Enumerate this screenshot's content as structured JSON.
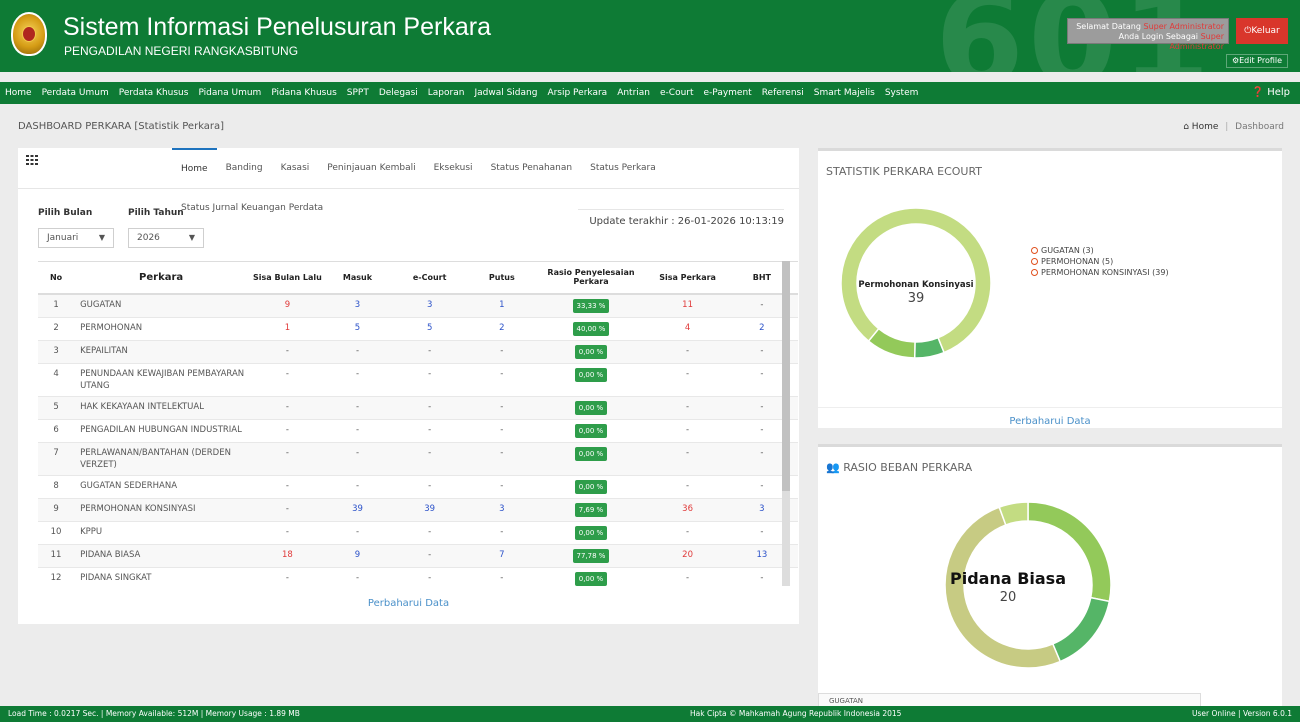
{
  "header": {
    "title": "Sistem Informasi Penelusuran Perkara",
    "subtitle": "PENGADILAN NEGERI RANGKASBITUNG",
    "watermark": "601",
    "welcome_line1": "Selamat Datang",
    "welcome_user1": "Super Administrator",
    "welcome_line2": "Anda Login Sebagai",
    "welcome_user2": "Super Administrator",
    "logout_label": "Keluar",
    "edit_profile_label": "Edit Profile"
  },
  "nav": {
    "items": [
      "Home",
      "Perdata Umum",
      "Perdata Khusus",
      "Pidana Umum",
      "Pidana Khusus",
      "SPPT",
      "Delegasi",
      "Laporan",
      "Jadwal Sidang",
      "Arsip Perkara",
      "Antrian",
      "e-Court",
      "e-Payment",
      "Referensi",
      "Smart Majelis",
      "System"
    ],
    "help": "Help"
  },
  "breadcrumb": {
    "heading": "DASHBOARD PERKARA",
    "heading_sub": "[Statistik Perkara]",
    "home": "Home",
    "current": "Dashboard"
  },
  "tabs": [
    "Home",
    "Banding",
    "Kasasi",
    "Peninjauan Kembali",
    "Eksekusi",
    "Status Penahanan",
    "Status Perkara",
    "Status Jurnal Keuangan Perdata"
  ],
  "filters": {
    "bulan_label": "Pilih Bulan",
    "bulan_value": "Januari",
    "tahun_label": "Pilih Tahun",
    "tahun_value": "2026",
    "updated": "Update terakhir : 26-01-2026 10:13:19"
  },
  "table": {
    "headers": [
      "No",
      "Perkara",
      "Sisa Bulan Lalu",
      "Masuk",
      "e-Court",
      "Putus",
      "Rasio Penyelesaian Perkara",
      "Sisa Perkara",
      "BHT"
    ],
    "rows": [
      [
        "1",
        "GUGATAN",
        "9",
        "3",
        "3",
        "1",
        "33,33 %",
        "11",
        "-"
      ],
      [
        "2",
        "PERMOHONAN",
        "1",
        "5",
        "5",
        "2",
        "40,00 %",
        "4",
        "2"
      ],
      [
        "3",
        "KEPAILITAN",
        "-",
        "-",
        "-",
        "-",
        "0,00 %",
        "-",
        "-"
      ],
      [
        "4",
        "PENUNDAAN KEWAJIBAN PEMBAYARAN UTANG",
        "-",
        "-",
        "-",
        "-",
        "0,00 %",
        "-",
        "-"
      ],
      [
        "5",
        "HAK KEKAYAAN INTELEKTUAL",
        "-",
        "-",
        "-",
        "-",
        "0,00 %",
        "-",
        "-"
      ],
      [
        "6",
        "PENGADILAN HUBUNGAN INDUSTRIAL",
        "-",
        "-",
        "-",
        "-",
        "0,00 %",
        "-",
        "-"
      ],
      [
        "7",
        "PERLAWANAN/BANTAHAN (DERDEN VERZET)",
        "-",
        "-",
        "-",
        "-",
        "0,00 %",
        "-",
        "-"
      ],
      [
        "8",
        "GUGATAN SEDERHANA",
        "-",
        "-",
        "-",
        "-",
        "0,00 %",
        "-",
        "-"
      ],
      [
        "9",
        "PERMOHONAN KONSINYASI",
        "-",
        "39",
        "39",
        "3",
        "7,69 %",
        "36",
        "3"
      ],
      [
        "10",
        "KPPU",
        "-",
        "-",
        "-",
        "-",
        "0,00 %",
        "-",
        "-"
      ],
      [
        "11",
        "PIDANA BIASA",
        "18",
        "9",
        "-",
        "7",
        "77,78 %",
        "20",
        "13"
      ],
      [
        "12",
        "PIDANA SINGKAT",
        "-",
        "-",
        "-",
        "-",
        "0,00 %",
        "-",
        "-"
      ]
    ],
    "refresh": "Perbaharui Data"
  },
  "ecourt": {
    "title": "STATISTIK PERKARA ECOURT",
    "legend": [
      "GUGATAN (3)",
      "PERMOHONAN (5)",
      "PERMOHONAN KONSINYASI (39)"
    ],
    "center_label": "Permohonan Konsinyasi",
    "center_value": "39",
    "refresh": "Perbaharui Data",
    "colors": [
      "#55b567",
      "#93c95a",
      "#c3dc82"
    ]
  },
  "rasio": {
    "title": "RASIO BEBAN PERKARA",
    "center_label": "Pidana Biasa",
    "center_value": "20",
    "bottom_text": "GUGATAN",
    "colors": [
      "#93c95a",
      "#55b567",
      "#c7cb83",
      "#c3dc82"
    ]
  },
  "chart_data": [
    {
      "type": "pie",
      "title": "STATISTIK PERKARA ECOURT",
      "categories": [
        "GUGATAN",
        "PERMOHONAN",
        "PERMOHONAN KONSINYASI"
      ],
      "values": [
        3,
        5,
        39
      ]
    },
    {
      "type": "pie",
      "title": "RASIO BEBAN PERKARA",
      "categories": [
        "PIDANA BIASA",
        "GUGATAN",
        "PERMOHONAN KONSINYASI",
        "PERMOHONAN"
      ],
      "values": [
        20,
        11,
        36,
        4
      ]
    }
  ],
  "footer": {
    "left": "Load Time : 0.0217 Sec. | Memory Available: 512M | Memory Usage : 1.89 MB",
    "center": "Hak Cipta © Mahkamah Agung Republik Indonesia 2015",
    "right": "User Online | Version 6.0.1"
  }
}
